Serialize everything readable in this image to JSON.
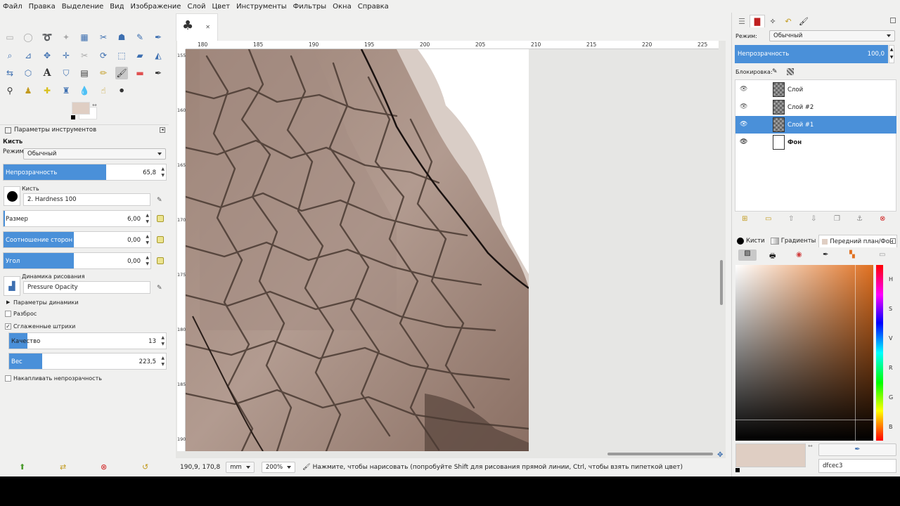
{
  "menu": [
    "Файл",
    "Правка",
    "Выделение",
    "Вид",
    "Изображение",
    "Слой",
    "Цвет",
    "Инструменты",
    "Фильтры",
    "Окна",
    "Справка"
  ],
  "colors": {
    "accent": "#4a90d9",
    "foreground": "#dfcec3",
    "background": "#ffffff"
  },
  "tool_options": {
    "dock_title": "Параметры инструментов",
    "tool_name": "Кисть",
    "mode_label": "Режим:",
    "mode_value": "Обычный",
    "opacity": {
      "label": "Непрозрачность",
      "value": "65,8",
      "fraction": 0.658
    },
    "brush_label": "Кисть",
    "brush_value": "2. Hardness 100",
    "size": {
      "label": "Размер",
      "value": "6,00"
    },
    "aspect": {
      "label": "Соотношение сторон",
      "value": "0,00"
    },
    "angle": {
      "label": "Угол",
      "value": "0,00"
    },
    "dynamics_label": "Динамика рисования",
    "dynamics_value": "Pressure Opacity",
    "dynamics_options": "Параметры динамики",
    "jitter": "Разброс",
    "smooth": "Сглаженные штрихи",
    "quality": {
      "label": "Качество",
      "value": "13"
    },
    "weight": {
      "label": "Вес",
      "value": "223,5"
    },
    "incremental": "Накапливать непрозрачность"
  },
  "ruler": {
    "top_labels": [
      "180",
      "185",
      "190",
      "195",
      "200",
      "205",
      "210",
      "215",
      "220",
      "225"
    ],
    "left_labels": [
      "155",
      "160",
      "165",
      "170",
      "175",
      "180",
      "185",
      "190"
    ]
  },
  "status": {
    "coords": "190,9, 170,8",
    "unit": "mm",
    "zoom": "200%",
    "message": "Нажмите, чтобы нарисовать (попробуйте Shift для рисования прямой линии, Ctrl, чтобы взять пипеткой цвет)"
  },
  "layers": {
    "mode_label": "Режим:",
    "mode_value": "Обычный",
    "opacity_label": "Непрозрачность",
    "opacity_value": "100,0",
    "lock_label": "Блокировка:",
    "items": [
      {
        "name": "Слой",
        "selected": false
      },
      {
        "name": "Слой #2",
        "selected": false
      },
      {
        "name": "Слой #1",
        "selected": true
      },
      {
        "name": "Фон",
        "selected": false
      }
    ]
  },
  "color_dock": {
    "tabs": [
      "Кисти",
      "Градиенты",
      "Передний план/Фон"
    ],
    "channels": [
      "H",
      "S",
      "V",
      "R",
      "G",
      "B"
    ],
    "hex": "dfcec3"
  }
}
